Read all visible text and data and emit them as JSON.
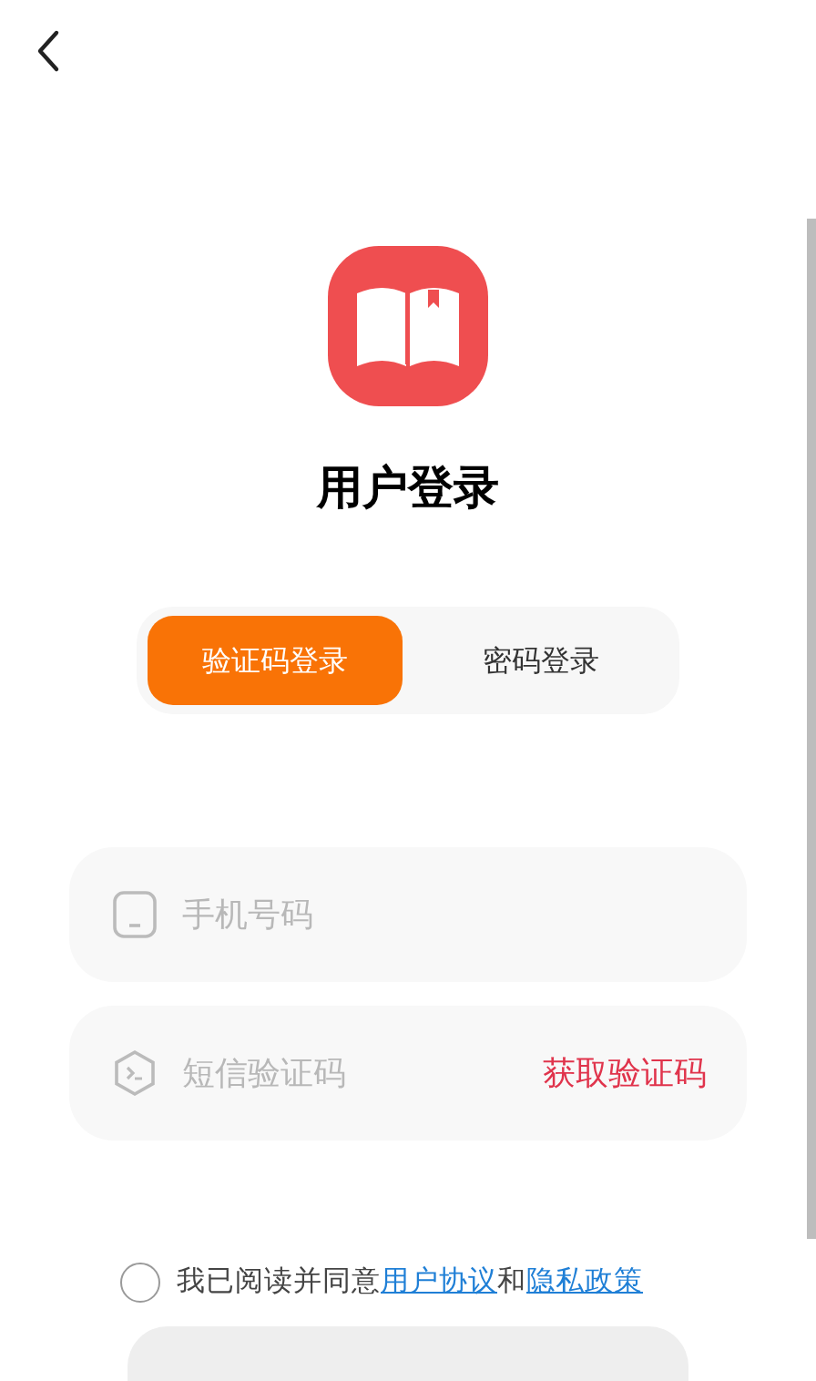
{
  "title": "用户登录",
  "tabs": [
    {
      "label": "验证码登录",
      "selected": true
    },
    {
      "label": "密码登录",
      "selected": false
    }
  ],
  "fields": [
    {
      "kind": "phone",
      "placeholder": "手机号码"
    },
    {
      "kind": "code",
      "placeholder": "短信验证码",
      "action": "获取验证码"
    }
  ],
  "agreement": {
    "checked": false,
    "text": "我已阅读并同意",
    "link_1": "用户协议",
    "joiner": "和",
    "link_2": "隐私政策"
  }
}
